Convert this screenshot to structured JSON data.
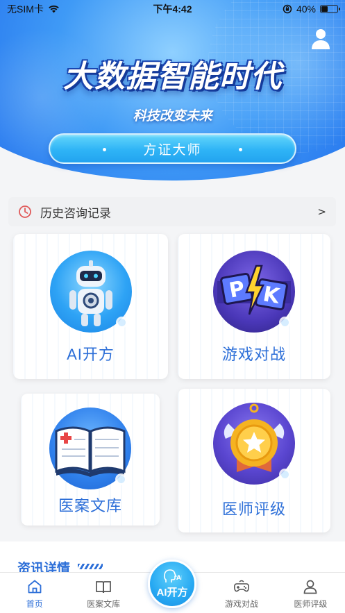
{
  "status_bar": {
    "carrier": "无SIM卡",
    "time": "下午4:42",
    "battery_text": "40%",
    "battery_level": 0.4
  },
  "hero": {
    "title": "大数据智能时代",
    "subtitle": "科技改变未来",
    "button_label": "方证大师",
    "profile_icon": "user-icon"
  },
  "history": {
    "label": "历史咨询记录",
    "chevron": ">",
    "icon": "clock-icon"
  },
  "features": {
    "ai_prescription": "AI开方",
    "game_battle": "游戏对战",
    "case_library": "医案文库",
    "doctor_rating": "医师评级"
  },
  "news": {
    "title": "资讯详情"
  },
  "tabbar": {
    "home": "首页",
    "case_library": "医案文库",
    "center": "AI开方",
    "center_glyph": "AI",
    "game": "游戏对战",
    "rating": "医师评级"
  },
  "colors": {
    "accent": "#2d6fd8",
    "hero_blue": "#2d7ff0",
    "button_cyan": "#2fb4f6"
  }
}
